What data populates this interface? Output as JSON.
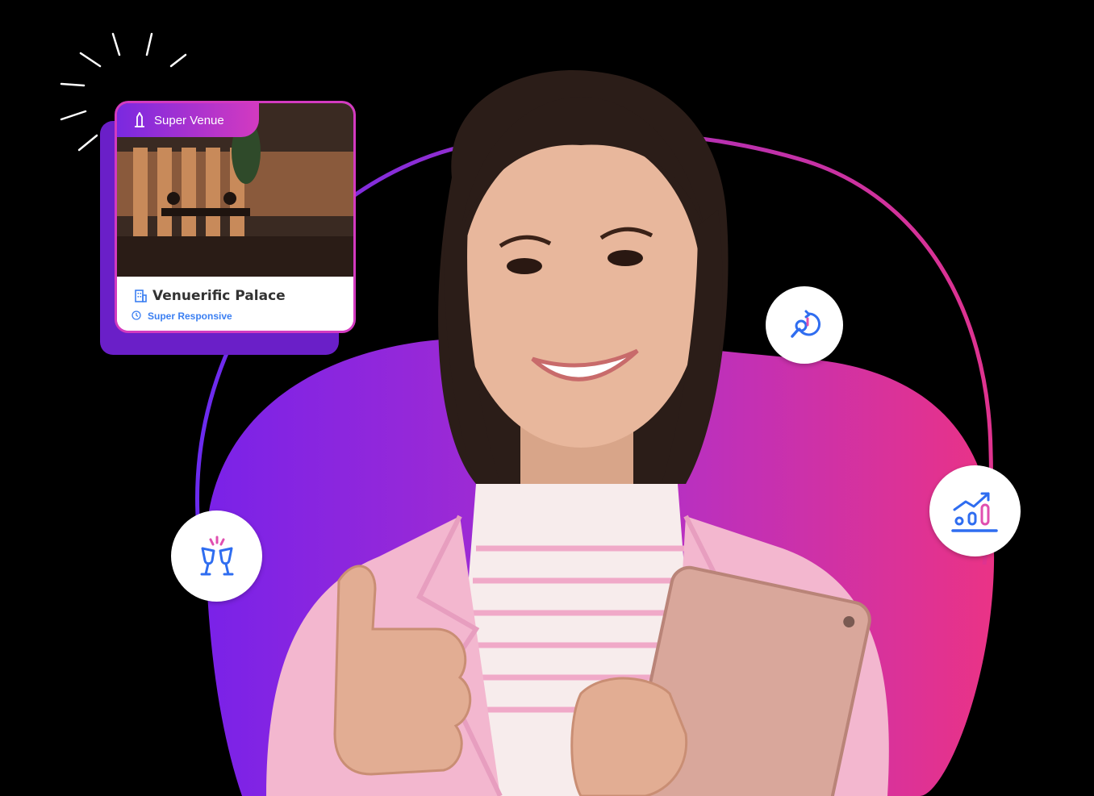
{
  "card": {
    "badge_label": "Super Venue",
    "venue_name": "Venuerific Palace",
    "status": "Super Responsive"
  },
  "icons": [
    "sparkle-lines-icon",
    "venue-badge-icon",
    "building-icon",
    "clock-icon",
    "search-refresh-icon",
    "toast-glasses-icon",
    "chart-growth-icon"
  ],
  "colors": {
    "purple": "#7a29e0",
    "magenta": "#e2338f",
    "accent_blue": "#2f6df0",
    "pink_jacket": "#f2b7cf"
  }
}
